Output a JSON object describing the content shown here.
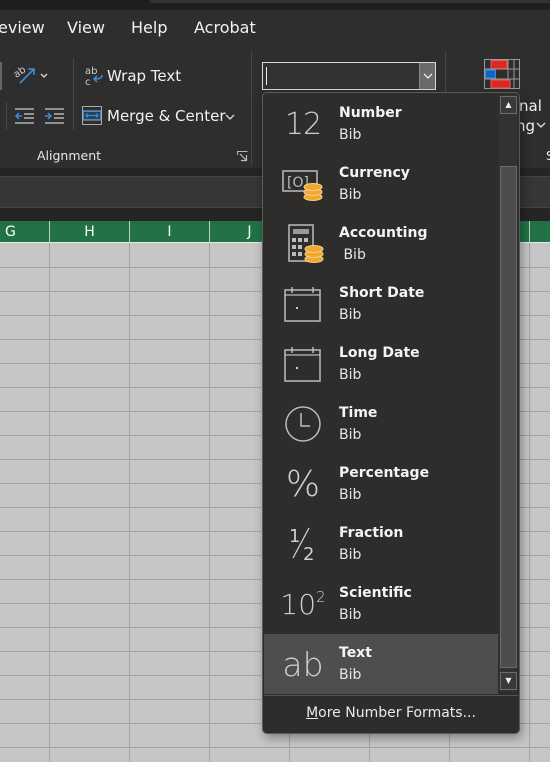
{
  "menubar": {
    "items": [
      "eview",
      "View",
      "Help",
      "Acrobat"
    ]
  },
  "ribbon": {
    "alignment": {
      "wrap_text_label": "Wrap Text",
      "merge_center_label": "Merge & Center",
      "group_label": "Alignment"
    },
    "number_format_input": {
      "value": ""
    },
    "conditional_formatting": {
      "label_line1": "nal",
      "label_line2": "ng"
    }
  },
  "columns": [
    "G",
    "H",
    "I",
    "J"
  ],
  "number_format_dropdown": {
    "items": [
      {
        "title": "Number",
        "preview": "Bib",
        "icon": "number-12-icon",
        "selected": false
      },
      {
        "title": "Currency",
        "preview": "Bib",
        "icon": "currency-icon",
        "selected": false
      },
      {
        "title": "Accounting",
        "preview": " Bib",
        "icon": "accounting-icon",
        "selected": false
      },
      {
        "title": "Short Date",
        "preview": "Bib",
        "icon": "calendar-icon",
        "selected": false
      },
      {
        "title": "Long Date",
        "preview": "Bib",
        "icon": "calendar-icon",
        "selected": false
      },
      {
        "title": "Time",
        "preview": "Bib",
        "icon": "clock-icon",
        "selected": false
      },
      {
        "title": "Percentage",
        "preview": "Bib",
        "icon": "percent-icon",
        "selected": false
      },
      {
        "title": "Fraction",
        "preview": "Bib",
        "icon": "fraction-icon",
        "selected": false
      },
      {
        "title": "Scientific",
        "preview": "Bib",
        "icon": "scientific-icon",
        "selected": false
      },
      {
        "title": "Text",
        "preview": "Bib",
        "icon": "text-ab-icon",
        "selected": true
      }
    ],
    "more_formats_accel": "M",
    "more_formats_rest": "ore Number Formats..."
  },
  "colors": {
    "header_green": "#217346",
    "accent_blue": "#3a8fd8",
    "coin_gold": "#e8a33a"
  }
}
